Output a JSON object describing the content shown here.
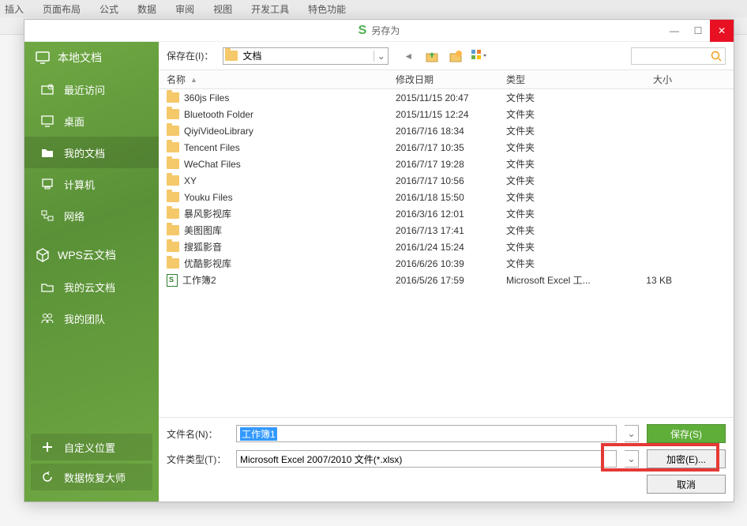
{
  "menubar": [
    "插入",
    "页面布局",
    "公式",
    "数据",
    "审阅",
    "视图",
    "开发工具",
    "特色功能"
  ],
  "dialog": {
    "title": "另存为",
    "saveInLabel": "保存在(I)：",
    "saveInValue": "文档",
    "sortArrow": "▲"
  },
  "sidebar": {
    "localHeader": "本地文档",
    "items": [
      {
        "label": "最近访问",
        "icon": "recent-icon"
      },
      {
        "label": "桌面",
        "icon": "desktop-icon"
      },
      {
        "label": "我的文档",
        "icon": "folder-icon",
        "selected": true
      },
      {
        "label": "计算机",
        "icon": "computer-icon"
      },
      {
        "label": "网络",
        "icon": "network-icon"
      }
    ],
    "cloudHeader": "WPS云文档",
    "cloudItems": [
      {
        "label": "我的云文档",
        "icon": "cloud-folder-icon"
      },
      {
        "label": "我的团队",
        "icon": "team-icon"
      }
    ],
    "bottom": [
      {
        "label": "自定义位置",
        "icon": "plus-icon"
      },
      {
        "label": "数据恢复大师",
        "icon": "refresh-icon"
      }
    ]
  },
  "columns": {
    "name": "名称",
    "date": "修改日期",
    "type": "类型",
    "size": "大小"
  },
  "files": [
    {
      "name": "360js Files",
      "date": "2015/11/15 20:47",
      "type": "文件夹",
      "size": "",
      "kind": "folder"
    },
    {
      "name": "Bluetooth Folder",
      "date": "2015/11/15 12:24",
      "type": "文件夹",
      "size": "",
      "kind": "folder"
    },
    {
      "name": "QiyiVideoLibrary",
      "date": "2016/7/16 18:34",
      "type": "文件夹",
      "size": "",
      "kind": "folder"
    },
    {
      "name": "Tencent Files",
      "date": "2016/7/17 10:35",
      "type": "文件夹",
      "size": "",
      "kind": "folder"
    },
    {
      "name": "WeChat Files",
      "date": "2016/7/17 19:28",
      "type": "文件夹",
      "size": "",
      "kind": "folder"
    },
    {
      "name": "XY",
      "date": "2016/7/17 10:56",
      "type": "文件夹",
      "size": "",
      "kind": "folder"
    },
    {
      "name": "Youku Files",
      "date": "2016/1/18 15:50",
      "type": "文件夹",
      "size": "",
      "kind": "folder"
    },
    {
      "name": "暴风影视库",
      "date": "2016/3/16 12:01",
      "type": "文件夹",
      "size": "",
      "kind": "folder"
    },
    {
      "name": "美图图库",
      "date": "2016/7/13 17:41",
      "type": "文件夹",
      "size": "",
      "kind": "folder"
    },
    {
      "name": "搜狐影音",
      "date": "2016/1/24 15:24",
      "type": "文件夹",
      "size": "",
      "kind": "folder"
    },
    {
      "name": "优酷影视库",
      "date": "2016/6/26 10:39",
      "type": "文件夹",
      "size": "",
      "kind": "folder"
    },
    {
      "name": "工作簿2",
      "date": "2016/5/26 17:59",
      "type": "Microsoft Excel 工...",
      "size": "13 KB",
      "kind": "xls"
    }
  ],
  "form": {
    "filenameLabel": "文件名(N)：",
    "filenameValue": "工作簿1",
    "filetypeLabel": "文件类型(T)：",
    "filetypeValue": "Microsoft Excel 2007/2010 文件(*.xlsx)",
    "saveBtn": "保存(S)",
    "encryptBtn": "加密(E)...",
    "cancelBtn": "取消"
  }
}
